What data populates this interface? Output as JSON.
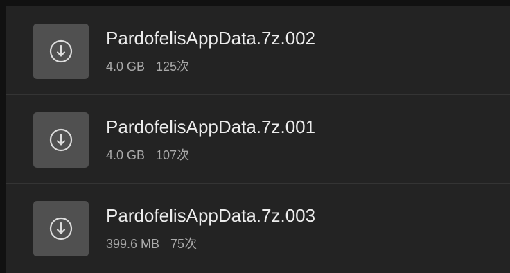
{
  "download_list": {
    "items": [
      {
        "file_name": "PardofelisAppData.7z.002",
        "size": "4.0 GB",
        "downloads": "125次",
        "icon": "download-icon"
      },
      {
        "file_name": "PardofelisAppData.7z.001",
        "size": "4.0 GB",
        "downloads": "107次",
        "icon": "download-icon"
      },
      {
        "file_name": "PardofelisAppData.7z.003",
        "size": "399.6 MB",
        "downloads": "75次",
        "icon": "download-icon"
      }
    ]
  },
  "colors": {
    "background": "#232323",
    "tile": "#505050",
    "title_text": "#ececec",
    "meta_text": "#a9a9a9"
  }
}
